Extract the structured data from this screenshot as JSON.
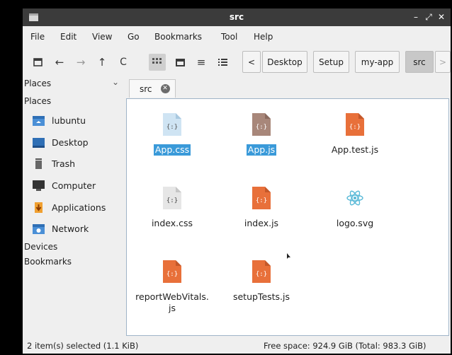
{
  "window": {
    "title": "src"
  },
  "menu": [
    "File",
    "Edit",
    "View",
    "Go",
    "Bookmarks",
    "Tool",
    "Help"
  ],
  "toolbar": {
    "buttons": [
      "new-window-icon",
      "back-arrow-icon",
      "forward-arrow-icon",
      "up-arrow-icon",
      "reload-icon",
      "icon-view-icon",
      "thumbnail-view-icon",
      "compact-view-icon",
      "detailed-list-view-icon"
    ],
    "path_prev": "<",
    "path_next": ">",
    "path": [
      "Desktop",
      "Setup",
      "my-app",
      "src"
    ]
  },
  "side_pane": {
    "mode": "Places",
    "sections": {
      "places": "Places",
      "devices": "Devices",
      "bookmarks": "Bookmarks"
    },
    "places_items": [
      {
        "label": "lubuntu",
        "icon": "home-folder-icon"
      },
      {
        "label": "Desktop",
        "icon": "desktop-icon"
      },
      {
        "label": "Trash",
        "icon": "trash-icon"
      },
      {
        "label": "Computer",
        "icon": "computer-icon"
      },
      {
        "label": "Applications",
        "icon": "applications-icon"
      },
      {
        "label": "Network",
        "icon": "network-icon"
      }
    ]
  },
  "tab": {
    "label": "src"
  },
  "files": [
    {
      "name": "App.css",
      "icon": "css-file-icon",
      "selected": true
    },
    {
      "name": "App.js",
      "icon": "js-file-icon",
      "selected": true
    },
    {
      "name": "App.test.js",
      "icon": "js-file-icon",
      "selected": false
    },
    {
      "name": "index.css",
      "icon": "css-file-icon",
      "selected": false
    },
    {
      "name": "index.js",
      "icon": "js-file-icon",
      "selected": false
    },
    {
      "name": "logo.svg",
      "icon": "react-svg-icon",
      "selected": false
    },
    {
      "name": "reportWebVitals.\njs",
      "icon": "js-file-icon",
      "selected": false
    },
    {
      "name": "setupTests.js",
      "icon": "js-file-icon",
      "selected": false
    }
  ],
  "colors": {
    "selection": "#3a9ad9",
    "js_icon": "#e8703a",
    "css_icon": "#d9d9d9",
    "react": "#58b9d7"
  },
  "status": {
    "left": "2 item(s) selected (1.1 KiB)",
    "right": "Free space: 924.9 GiB (Total: 983.3 GiB)"
  }
}
